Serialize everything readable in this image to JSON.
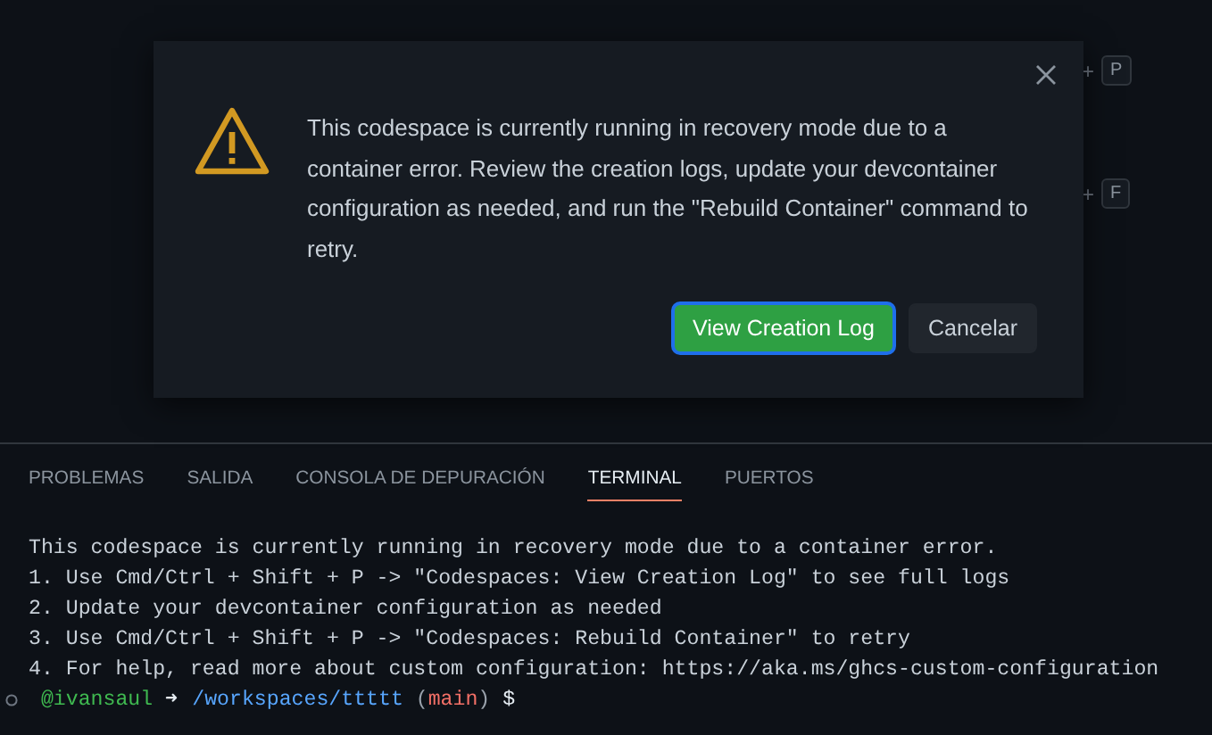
{
  "shortcut_hints": [
    {
      "plus": "+",
      "key": "P"
    },
    {
      "plus": "+",
      "key": "F"
    }
  ],
  "dialog": {
    "message": "This codespace is currently running in recovery mode due to a container error. Review the creation logs, update your devcontainer configuration as needed, and run the \"Rebuild Container\" command to retry.",
    "buttons": [
      {
        "label": "View Creation Log",
        "kind": "primary"
      },
      {
        "label": "Cancelar",
        "kind": "secondary"
      }
    ]
  },
  "panel_tabs": [
    {
      "label": "PROBLEMAS",
      "selected": false
    },
    {
      "label": "SALIDA",
      "selected": false
    },
    {
      "label": "CONSOLA DE DEPURACIÓN",
      "selected": false
    },
    {
      "label": "TERMINAL",
      "selected": true
    },
    {
      "label": "PUERTOS",
      "selected": false
    }
  ],
  "terminal": {
    "lines": [
      "This codespace is currently running in recovery mode due to a container error.",
      "1. Use Cmd/Ctrl + Shift + P -> \"Codespaces: View Creation Log\" to see full logs",
      "2. Update your devcontainer configuration as needed",
      "3. Use Cmd/Ctrl + Shift + P -> \"Codespaces: Rebuild Container\" to retry",
      "4. For help, read more about custom configuration: https://aka.ms/ghcs-custom-configuration"
    ],
    "prompt": [
      {
        "text": "@ivansaul",
        "kind": "user"
      },
      {
        "text": "➜",
        "kind": "arrow"
      },
      {
        "text": "/workspaces/ttttt",
        "kind": "path"
      },
      {
        "text": "(",
        "kind": "paren"
      },
      {
        "text": "main",
        "kind": "branch"
      },
      {
        "text": ")",
        "kind": "paren"
      },
      {
        "text": "$",
        "kind": "symbol"
      }
    ]
  }
}
